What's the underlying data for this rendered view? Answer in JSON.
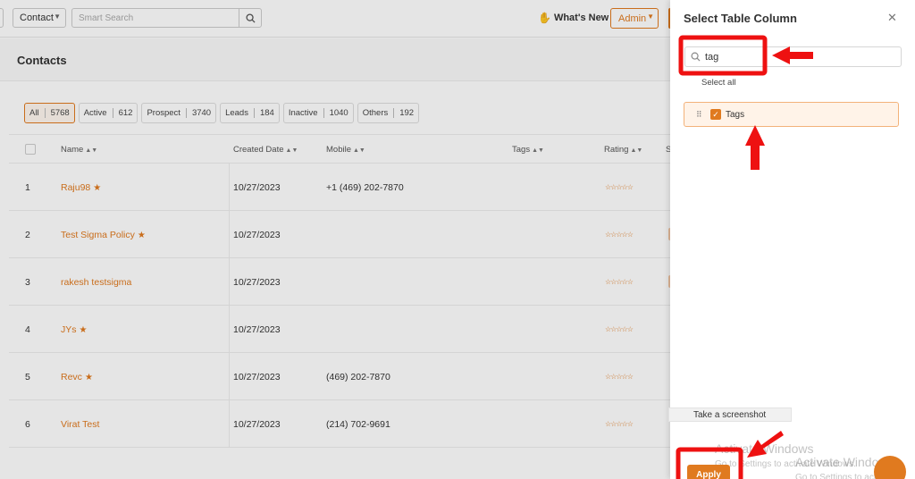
{
  "topbar": {
    "context_select": "Contact",
    "search_placeholder": "Smart Search",
    "whats_new": "What's New",
    "admin": "Admin"
  },
  "page": {
    "title": "Contacts"
  },
  "filters": [
    {
      "label": "All",
      "count": "5768",
      "active": true
    },
    {
      "label": "Active",
      "count": "612"
    },
    {
      "label": "Prospect",
      "count": "3740"
    },
    {
      "label": "Leads",
      "count": "184"
    },
    {
      "label": "Inactive",
      "count": "1040"
    },
    {
      "label": "Others",
      "count": "192"
    }
  ],
  "table": {
    "headers": {
      "name": "Name",
      "created": "Created Date",
      "mobile": "Mobile",
      "tags": "Tags",
      "rating": "Rating",
      "extra": "S"
    },
    "rows": [
      {
        "num": "1",
        "name": "Raju98",
        "star": true,
        "created": "10/27/2023",
        "mobile": "+1 (469) 202-7870",
        "tag": false
      },
      {
        "num": "2",
        "name": "Test Sigma Policy",
        "star": true,
        "created": "10/27/2023",
        "mobile": "",
        "tag": true
      },
      {
        "num": "3",
        "name": "rakesh testsigma",
        "star": false,
        "created": "10/27/2023",
        "mobile": "",
        "tag": true
      },
      {
        "num": "4",
        "name": "JYs",
        "star": true,
        "created": "10/27/2023",
        "mobile": "",
        "tag": false
      },
      {
        "num": "5",
        "name": "Revc",
        "star": true,
        "created": "10/27/2023",
        "mobile": "(469) 202-7870",
        "tag": false
      },
      {
        "num": "6",
        "name": "Virat Test",
        "star": false,
        "created": "10/27/2023",
        "mobile": "(214) 702-9691",
        "tag": false
      }
    ]
  },
  "panel": {
    "title": "Select Table Column",
    "search_value": "tag",
    "select_all": "Select all",
    "columns": [
      {
        "label": "Tags",
        "checked": true
      }
    ],
    "screenshot_tip": "Take a screenshot",
    "apply": "Apply",
    "watermark_title": "Activate Windows",
    "watermark_sub": "Go to Settings to activate Windows."
  },
  "icons": {
    "search": "search-icon",
    "close": "close-icon",
    "drag": "drag-handle-icon",
    "check": "checkbox-checked-icon",
    "star": "star-icon",
    "hand": "hand-icon"
  },
  "colors": {
    "accent": "#e07a1f",
    "annotation": "#ee1111",
    "item_bg": "#fff3e8"
  }
}
